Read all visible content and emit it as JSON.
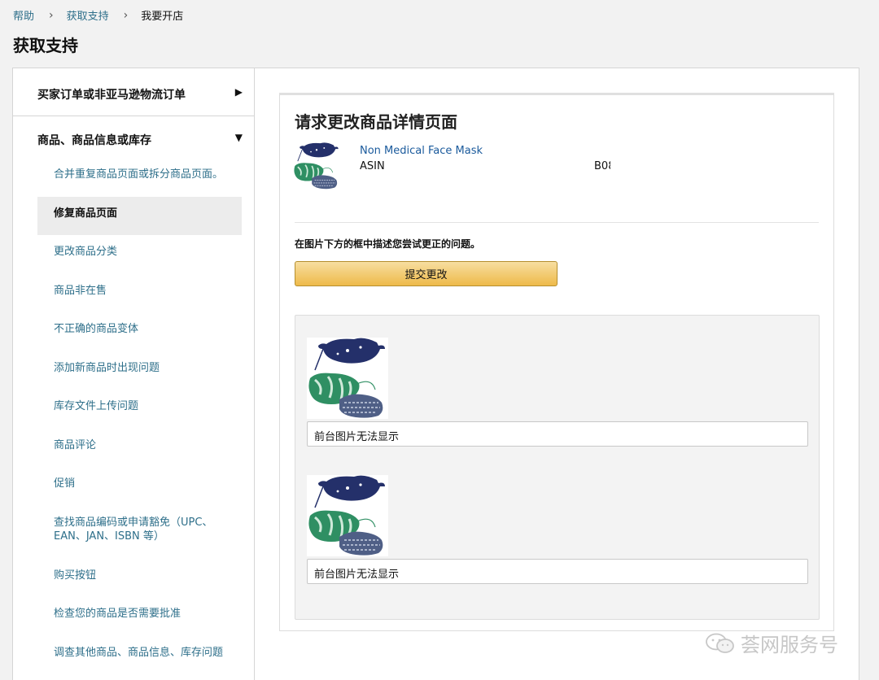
{
  "breadcrumb": {
    "items": [
      "帮助",
      "获取支持",
      "我要开店"
    ],
    "separator": "›"
  },
  "page_title": "获取支持",
  "sidebar": {
    "categories": [
      {
        "label": "买家订单或非亚马逊物流订单",
        "arrow": "▶"
      },
      {
        "label": "商品、商品信息或库存",
        "arrow": "▼"
      }
    ],
    "subitems": [
      {
        "label": "合并重复商品页面或拆分商品页面。"
      },
      {
        "label": "修复商品页面",
        "active": true
      },
      {
        "label": "更改商品分类"
      },
      {
        "label": "商品非在售"
      },
      {
        "label": "不正确的商品变体"
      },
      {
        "label": "添加新商品时出现问题"
      },
      {
        "label": "库存文件上传问题"
      },
      {
        "label": "商品评论"
      },
      {
        "label": "促销"
      },
      {
        "label": "查找商品编码或申请豁免（UPC、EAN、JAN、ISBN 等）"
      },
      {
        "label": "购买按钮"
      },
      {
        "label": "检查您的商品是否需要批准"
      },
      {
        "label": "调查其他商品、商品信息、库存问题"
      }
    ]
  },
  "content": {
    "title": "请求更改商品详情页面",
    "product": {
      "name": "Non Medical Face Mask",
      "asin_label": "ASIN",
      "asin_value": "B08"
    },
    "instruction": "在图片下方的框中描述您尝试更正的问题。",
    "submit_label": "提交更改",
    "images": [
      {
        "description": "前台图片无法显示"
      },
      {
        "description": "前台图片无法显示"
      }
    ]
  },
  "watermark": {
    "text": "荟网服务号"
  },
  "colors": {
    "link": "#2e6f8a",
    "product_link": "#1a5a9c",
    "button": "#f0c14b"
  }
}
